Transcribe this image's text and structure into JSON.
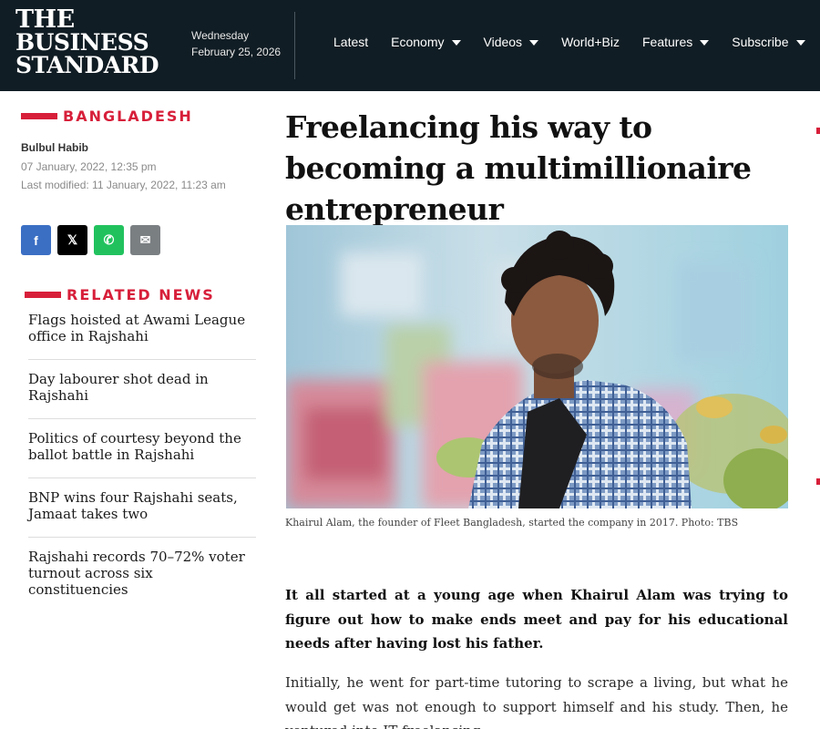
{
  "header": {
    "logo_lines": [
      "THE",
      "BUSINESS",
      "STANDARD"
    ],
    "weekday": "Wednesday",
    "date": "February 25, 2026",
    "nav": [
      {
        "label": "Latest",
        "has_dropdown": false
      },
      {
        "label": "Economy",
        "has_dropdown": true
      },
      {
        "label": "Videos",
        "has_dropdown": true
      },
      {
        "label": "World+Biz",
        "has_dropdown": false
      },
      {
        "label": "Features",
        "has_dropdown": true
      },
      {
        "label": "Subscribe",
        "has_dropdown": true
      }
    ]
  },
  "sidebar": {
    "section": "BANGLADESH",
    "author": "Bulbul Habib",
    "published": "07 January, 2022, 12:35 pm",
    "modified": "Last modified: 11 January, 2022, 11:23 am",
    "share": [
      {
        "icon": "facebook-icon",
        "glyph": "f"
      },
      {
        "icon": "x-icon",
        "glyph": "𝕏"
      },
      {
        "icon": "whatsapp-icon",
        "glyph": "✆"
      },
      {
        "icon": "email-icon",
        "glyph": "✉"
      }
    ],
    "related_title": "RELATED NEWS",
    "related": [
      "Flags hoisted at Awami League office in Rajshahi",
      "Day labourer shot dead in Rajshahi",
      "Politics of courtesy beyond the ballot battle in Rajshahi",
      "BNP wins four Rajshahi seats, Jamaat takes two",
      "Rajshahi records 70–72% voter turnout across six constituencies"
    ]
  },
  "article": {
    "headline": "Freelancing his way to becoming a multimillionaire entrepreneur",
    "caption": "Khairul Alam, the founder of Fleet Bangladesh, started the company in 2017. Photo: TBS",
    "lead": "It all started at a young age when Khairul Alam was trying to figure out how to make ends meet and pay for his educational needs after having lost his father.",
    "body": "Initially, he went for part-time tutoring to scrape a living, but what he would get was not enough to support himself and his study. Then, he ventured into IT freelancing."
  },
  "colors": {
    "header_bg": "#111d24",
    "accent_red": "#d71f3a",
    "facebook": "#3b6fc4",
    "whatsapp": "#21c25e"
  }
}
